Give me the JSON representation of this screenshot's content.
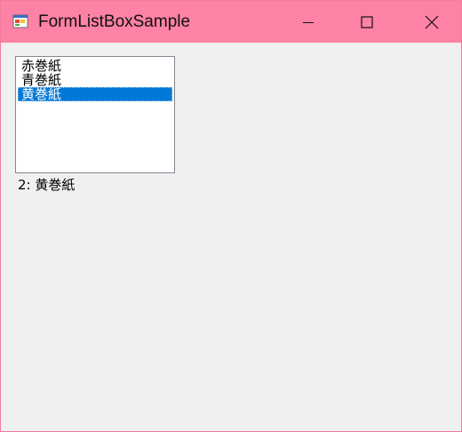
{
  "window": {
    "title": "FormListBoxSample",
    "icon": "form-app-icon",
    "colors": {
      "titlebar": "#fd82a6",
      "selection": "#0078d7",
      "background": "#f0f0f0"
    }
  },
  "listbox": {
    "items": [
      "赤巻紙",
      "青巻紙",
      "黄巻紙"
    ],
    "selected_index": 2
  },
  "status": {
    "text": "2: 黄巻紙"
  }
}
